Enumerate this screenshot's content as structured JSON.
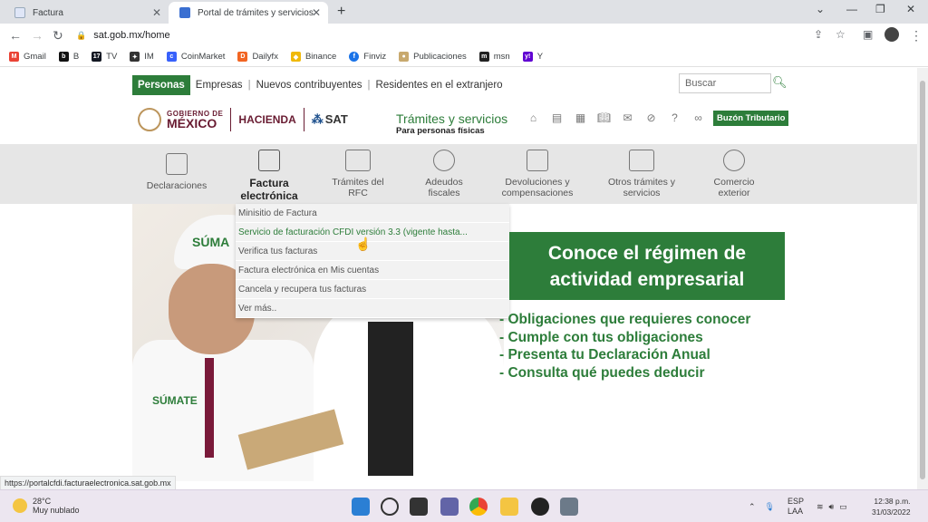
{
  "browser": {
    "tabs": [
      {
        "title": "Factura"
      },
      {
        "title": "Portal de trámites y servicios - SA"
      }
    ],
    "url": "sat.gob.mx/home",
    "bookmarks": [
      "Gmail",
      "B",
      "TV",
      "IM",
      "CoinMarket",
      "Dailyfx",
      "Binance",
      "Finviz",
      "Publicaciones",
      "msn",
      "Y"
    ],
    "status_url": "https://portalcfdi.facturaelectronica.sat.gob.mx"
  },
  "site": {
    "topnav": {
      "active": "Personas",
      "items": [
        "Empresas",
        "Nuevos contribuyentes",
        "Residentes en el extranjero"
      ]
    },
    "search_placeholder": "Buscar",
    "logos": {
      "gob_line1": "GOBIERNO DE",
      "gob_line2": "MÉXICO",
      "hacienda": "HACIENDA",
      "sat": "SAT"
    },
    "tramites_title": "Trámites y servicios",
    "tramites_sub": "Para personas físicas",
    "buzon": "Buzón Tributario",
    "menu": [
      {
        "label": "Declaraciones"
      },
      {
        "label": "Factura electrónica"
      },
      {
        "label": "Trámites del RFC"
      },
      {
        "label": "Adeudos fiscales"
      },
      {
        "label": "Devoluciones y compensaciones"
      },
      {
        "label": "Otros trámites y servicios"
      },
      {
        "label": "Comercio exterior"
      }
    ],
    "dropdown": [
      "Minisitio de Factura",
      "Servicio de facturación CFDI versión 3.3 (vigente hasta...",
      "Verifica tus facturas",
      "Factura electrónica en Mis cuentas",
      "Cancela y recupera tus facturas",
      "Ver más.."
    ],
    "hero": {
      "cap_text": "SÚMA",
      "badge_text": "SÚMATE",
      "box_title": "Conoce el régimen de actividad empresarial",
      "list": [
        "- Obligaciones que requieres conocer",
        "- Cumple con tus obligaciones",
        "- Presenta tu Declaración Anual",
        "- Consulta qué puedes deducir"
      ]
    }
  },
  "taskbar": {
    "weather_temp": "28°C",
    "weather_desc": "Muy nublado",
    "lang1": "ESP",
    "lang2": "LAA",
    "time": "12:38 p.m.",
    "date": "31/03/2022"
  }
}
